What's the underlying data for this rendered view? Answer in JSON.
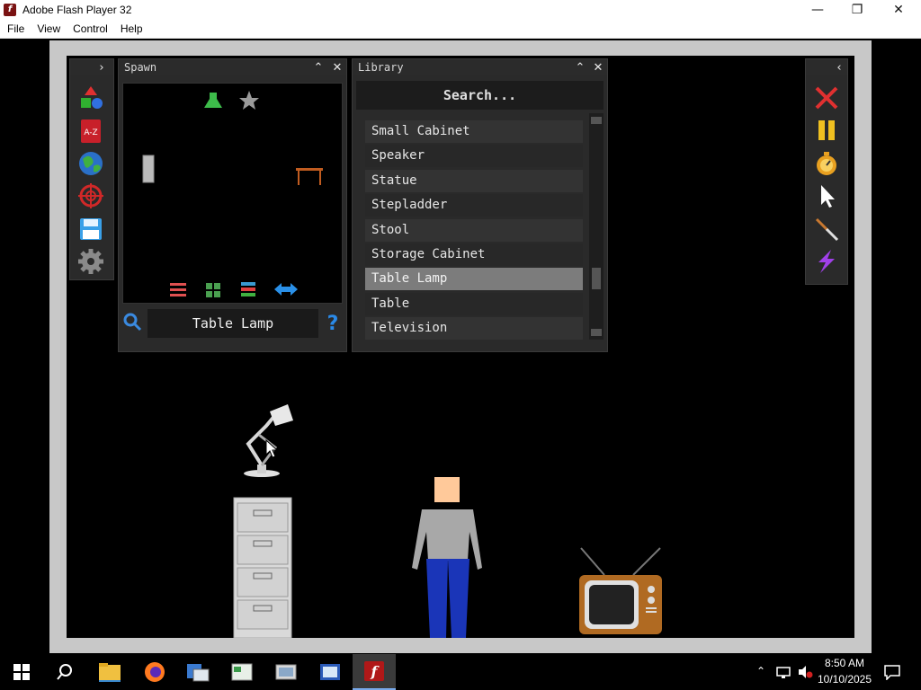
{
  "window": {
    "title": "Adobe Flash Player 32",
    "minimize_glyph": "—",
    "restore_glyph": "❐",
    "close_glyph": "✕"
  },
  "menu": {
    "items": [
      "File",
      "View",
      "Control",
      "Help"
    ]
  },
  "spawn_panel": {
    "title": "Spawn",
    "search_value": "Table Lamp",
    "help_glyph": "?"
  },
  "library_panel": {
    "title": "Library",
    "search_label": "Search...",
    "items": [
      "Small Cabinet",
      "Speaker",
      "Statue",
      "Stepladder",
      "Stool",
      "Storage Cabinet",
      "Table Lamp",
      "Table",
      "Television"
    ],
    "selected_index": 6
  },
  "left_toolbar": {
    "icons": [
      "shapes-icon",
      "a-z-book-icon",
      "globe-icon",
      "target-icon",
      "save-icon",
      "gear-icon"
    ]
  },
  "right_toolbar": {
    "icons": [
      "close-red-icon",
      "pause-icon",
      "stopwatch-icon",
      "cursor-icon",
      "knife-icon",
      "lightning-icon"
    ]
  },
  "taskbar": {
    "time": "8:50 AM",
    "date": "10/10/2025"
  },
  "colors": {
    "panel_bg": "#2a2a2a",
    "selected_row": "#7c7c7c",
    "stage_frame": "#c8c8c8",
    "taskbar_active": "#3a3a3a"
  }
}
